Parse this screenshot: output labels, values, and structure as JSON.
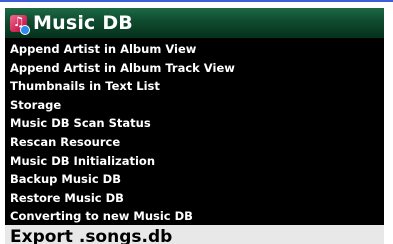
{
  "window": {
    "title": "Music DB"
  },
  "header": {
    "icon": "music-note-icon"
  },
  "menu": {
    "items": [
      {
        "label": "Append Artist in Album View"
      },
      {
        "label": "Append Artist in Album Track View"
      },
      {
        "label": "Thumbnails in Text List"
      },
      {
        "label": "Storage"
      },
      {
        "label": "Music DB Scan Status"
      },
      {
        "label": "Rescan Resource"
      },
      {
        "label": "Music DB Initialization"
      },
      {
        "label": "Backup Music DB"
      },
      {
        "label": "Restore Music DB"
      },
      {
        "label": "Converting to new Music DB"
      }
    ],
    "selected": {
      "label": "Export .songs.db"
    }
  },
  "colors": {
    "header_bg": "#0f4a2e",
    "panel_bg": "#000000",
    "selected_bg": "#e8e8e8",
    "accent_line": "#3c5fd6",
    "icon_pink": "#d2285a"
  }
}
